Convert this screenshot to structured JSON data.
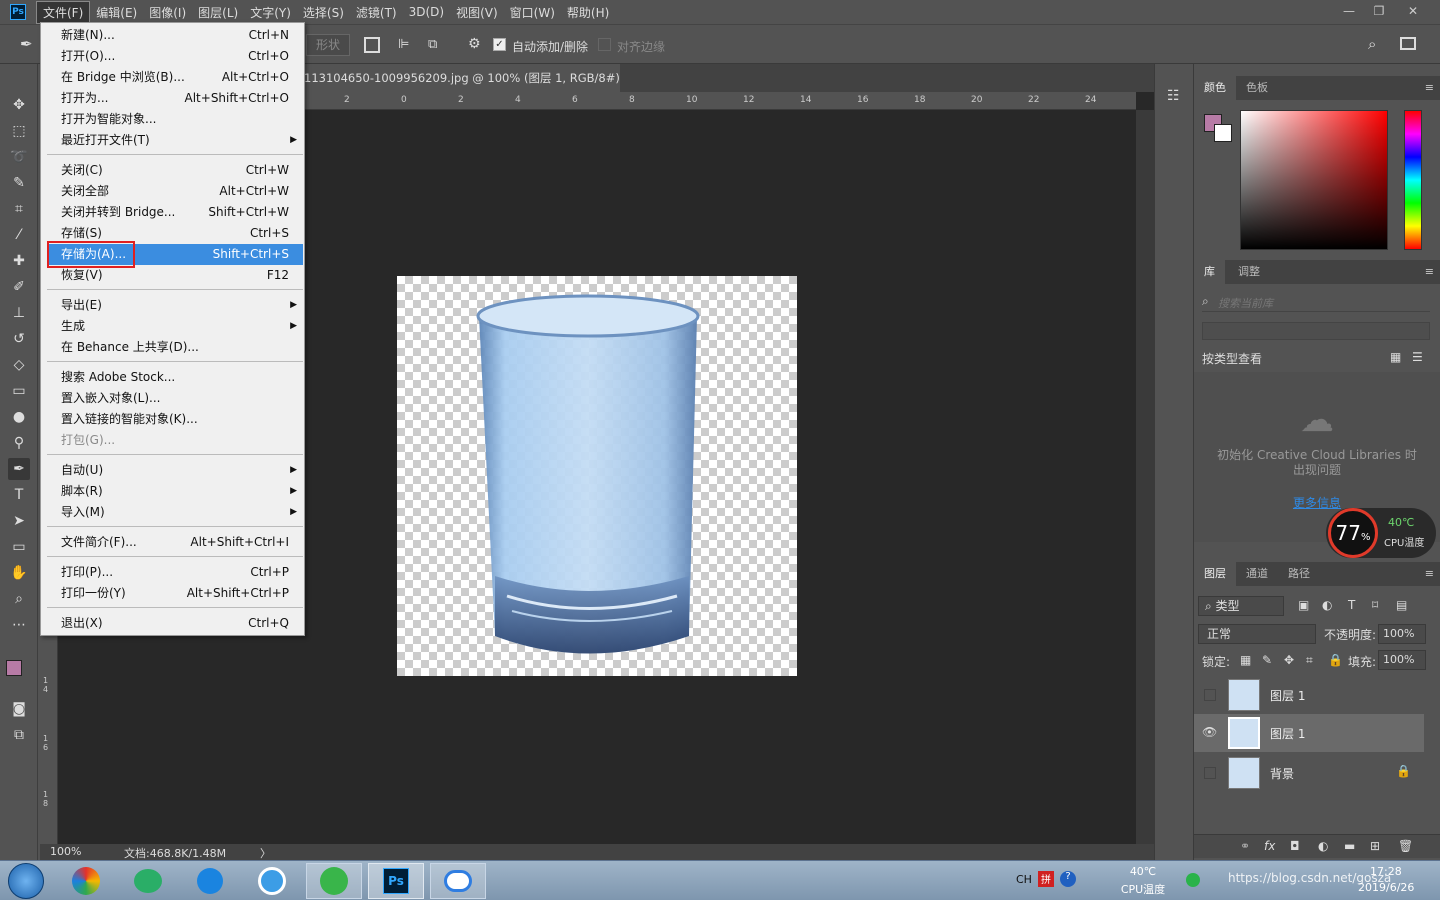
{
  "menubar": {
    "logo": "Ps",
    "items": [
      "文件(F)",
      "编辑(E)",
      "图像(I)",
      "图层(L)",
      "文字(Y)",
      "选择(S)",
      "滤镜(T)",
      "3D(D)",
      "视图(V)",
      "窗口(W)",
      "帮助(H)"
    ]
  },
  "window_controls": {
    "minimize": "—",
    "restore": "❐",
    "close": "✕"
  },
  "options": {
    "shape_label": "形状",
    "auto_add_delete": "自动添加/删除",
    "align_edges": "对齐边缘"
  },
  "document": {
    "tab_title": "113104650-1009956209.jpg @ 100% (图层 1, RGB/8#) *",
    "tab_close": "×",
    "ruler_marks": [
      "2",
      "0",
      "2",
      "4",
      "6",
      "8",
      "10",
      "12",
      "14",
      "16",
      "18",
      "20",
      "22",
      "24"
    ],
    "left_ruler_marks": [
      "1\n4",
      "1\n6",
      "1\n8"
    ],
    "zoom": "100%",
    "doc_info": "文档:468.8K/1.48M",
    "status_arrow": "〉"
  },
  "file_menu": {
    "items": [
      {
        "label": "新建(N)...",
        "shortcut": "Ctrl+N"
      },
      {
        "label": "打开(O)...",
        "shortcut": "Ctrl+O"
      },
      {
        "label": "在 Bridge 中浏览(B)...",
        "shortcut": "Alt+Ctrl+O"
      },
      {
        "label": "打开为...",
        "shortcut": "Alt+Shift+Ctrl+O"
      },
      {
        "label": "打开为智能对象...",
        "shortcut": ""
      },
      {
        "label": "最近打开文件(T)",
        "shortcut": "",
        "submenu": true
      },
      {
        "label": "关闭(C)",
        "shortcut": "Ctrl+W"
      },
      {
        "label": "关闭全部",
        "shortcut": "Alt+Ctrl+W"
      },
      {
        "label": "关闭并转到 Bridge...",
        "shortcut": "Shift+Ctrl+W"
      },
      {
        "label": "存储(S)",
        "shortcut": "Ctrl+S"
      },
      {
        "label": "存储为(A)...",
        "shortcut": "Shift+Ctrl+S",
        "highlighted": true
      },
      {
        "label": "恢复(V)",
        "shortcut": "F12"
      },
      {
        "label": "导出(E)",
        "shortcut": "",
        "submenu": true
      },
      {
        "label": "生成",
        "shortcut": "",
        "submenu": true
      },
      {
        "label": "在 Behance 上共享(D)...",
        "shortcut": ""
      },
      {
        "label": "搜索 Adobe Stock...",
        "shortcut": ""
      },
      {
        "label": "置入嵌入对象(L)...",
        "shortcut": ""
      },
      {
        "label": "置入链接的智能对象(K)...",
        "shortcut": ""
      },
      {
        "label": "打包(G)...",
        "shortcut": "",
        "disabled": true
      },
      {
        "label": "自动(U)",
        "shortcut": "",
        "submenu": true
      },
      {
        "label": "脚本(R)",
        "shortcut": "",
        "submenu": true
      },
      {
        "label": "导入(M)",
        "shortcut": "",
        "submenu": true
      },
      {
        "label": "文件简介(F)...",
        "shortcut": "Alt+Shift+Ctrl+I"
      },
      {
        "label": "打印(P)...",
        "shortcut": "Ctrl+P"
      },
      {
        "label": "打印一份(Y)",
        "shortcut": "Alt+Shift+Ctrl+P"
      },
      {
        "label": "退出(X)",
        "shortcut": "Ctrl+Q"
      }
    ]
  },
  "color_panel": {
    "tabs": [
      "颜色",
      "色板"
    ],
    "foreground": "#b77ba6",
    "background": "#ffffff"
  },
  "libraries_panel": {
    "tabs": [
      "库",
      "调整"
    ],
    "search_placeholder": "搜索当前库",
    "view_by": "按类型查看",
    "message": "初始化 Creative Cloud Libraries 时出现问题",
    "more_info": "更多信息"
  },
  "cpu_widget": {
    "percent": "77",
    "unit": "%",
    "temp": "40℃",
    "label": "CPU温度"
  },
  "layers_panel": {
    "tabs": [
      "图层",
      "通道",
      "路径"
    ],
    "filter": "类型",
    "blend": "正常",
    "opacity_label": "不透明度:",
    "opacity": "100%",
    "lock_label": "锁定:",
    "fill_label": "填充:",
    "fill": "100%",
    "layers": [
      {
        "name": "图层 1",
        "visible": false,
        "locked": false
      },
      {
        "name": "图层 1",
        "visible": true,
        "locked": false,
        "selected": true
      },
      {
        "name": "背景",
        "visible": false,
        "locked": true
      }
    ]
  },
  "taskbar": {
    "lang": "CH",
    "cpu_temp": "40℃",
    "cpu_label": "CPU温度",
    "time": "17:28",
    "date": "2019/6/26",
    "watermark": "https://blog.csdn.net/gosza"
  }
}
